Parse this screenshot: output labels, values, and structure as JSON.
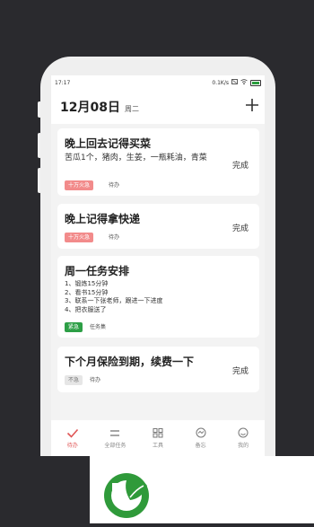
{
  "status_bar": {
    "time": "17:17",
    "speed": "0.1K/s"
  },
  "header": {
    "date": "12月08日",
    "weekday": "周二",
    "add_icon": "plus-icon"
  },
  "tasks": [
    {
      "title": "晚上回去记得买菜",
      "desc": "苦瓜1个，猪肉，生姜，一瓶耗油，青菜",
      "tag": "十万火急",
      "tag_color": "#f28b8b",
      "status": "待办",
      "action": "完成"
    },
    {
      "title": "晚上记得拿快递",
      "tag": "十万火急",
      "tag_color": "#f28b8b",
      "status": "待办",
      "action": "完成"
    },
    {
      "title": "周一任务安排",
      "desc_lines": [
        "1、锻炼15分钟",
        "2、看书15分钟",
        "3、联系一下张老师，跟进一下进度",
        "4、把衣服送了"
      ],
      "tag": "紧急",
      "tag_color": "#2d9f46",
      "status": "任务集"
    },
    {
      "title": "下个月保险到期，续费一下",
      "tag": "不急",
      "tag_color": "#e6e6e6",
      "status": "待办",
      "action": "完成"
    }
  ],
  "tabbar": [
    {
      "label": "待办",
      "icon": "check-icon",
      "active": true
    },
    {
      "label": "全部任务",
      "icon": "list-icon"
    },
    {
      "label": "工具",
      "icon": "grid-icon"
    },
    {
      "label": "备忘",
      "icon": "memo-icon"
    },
    {
      "label": "我的",
      "icon": "profile-icon"
    }
  ],
  "logo": {
    "icon": "leaf-logo-icon",
    "color": "#2f9a3a"
  }
}
